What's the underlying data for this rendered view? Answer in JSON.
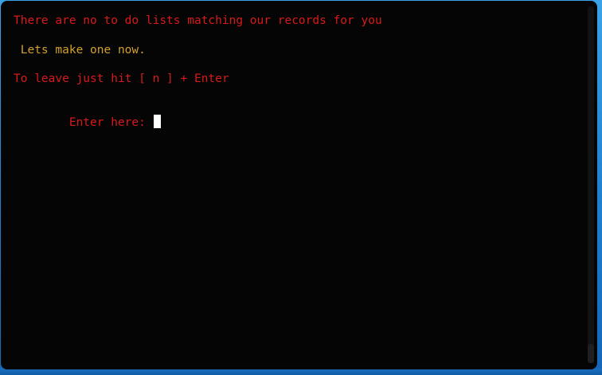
{
  "terminal": {
    "lines": [
      "There are no to do lists matching our records for you",
      " Lets make one now.",
      "To leave just hit [ n ] + Enter",
      "Enter here: "
    ],
    "input_value": ""
  },
  "colors": {
    "background": "#050505",
    "error_text": "#d81a1a",
    "info_text": "#d3a02e",
    "cursor": "#ffffff",
    "desktop": "#2a8fd6"
  }
}
